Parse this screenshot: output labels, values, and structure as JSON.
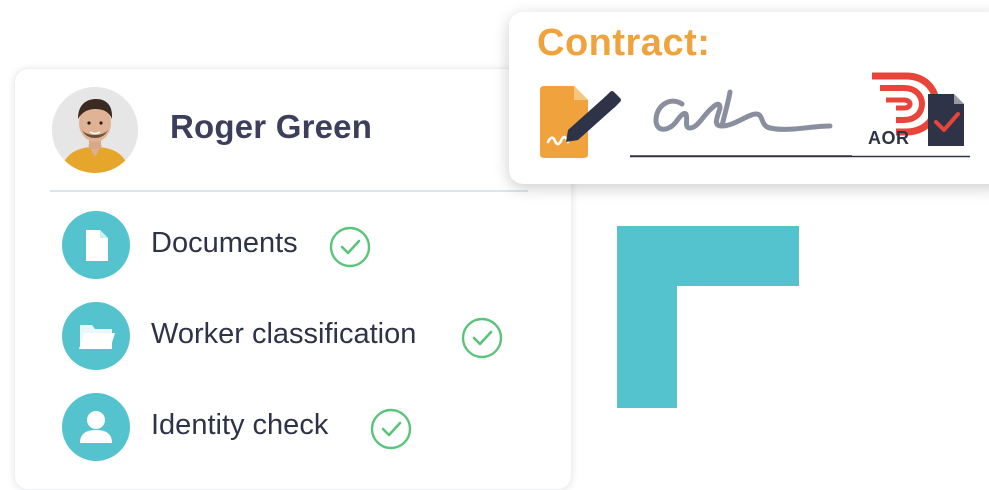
{
  "profile": {
    "name": "Roger Green",
    "avatar_icon": "person-photo-avatar"
  },
  "checklist": [
    {
      "label": "Documents",
      "icon": "document-icon",
      "status": "completed"
    },
    {
      "label": "Worker classification",
      "icon": "folder-icon",
      "status": "completed"
    },
    {
      "label": "Identity check",
      "icon": "person-icon",
      "status": "completed"
    }
  ],
  "contract": {
    "title": "Contract:",
    "document_icon": "signed-document-pen-icon",
    "signature": "handwritten-signature",
    "logo_text": "AOR"
  },
  "colors": {
    "teal": "#55c3ce",
    "orange": "#f0a33c",
    "navy": "#2f3347",
    "check_green": "#5ac47a",
    "logo_red": "#e8443a"
  }
}
